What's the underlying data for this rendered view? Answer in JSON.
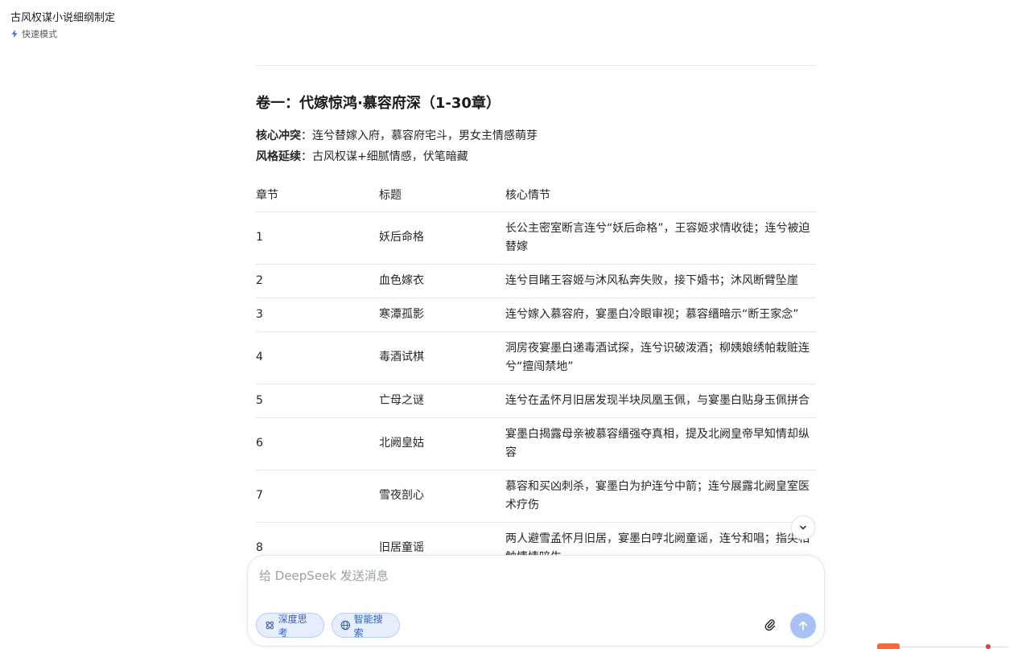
{
  "header": {
    "chat_title": "古风权谋小说细纲制定",
    "mode_label": "快速模式",
    "mode_icon": "lightning-icon"
  },
  "content": {
    "volume_heading": "卷一：代嫁惊鸿·慕容府深（1-30章）",
    "meta": [
      {
        "label": "核心冲突",
        "text": "：连兮替嫁入府，慕容府宅斗，男女主情感萌芽"
      },
      {
        "label": "风格延续",
        "text": "：古风权谋+细腻情感，伏笔暗藏"
      }
    ],
    "table": {
      "headers": [
        "章节",
        "标题",
        "核心情节"
      ],
      "rows": [
        {
          "ch": "1",
          "title": "妖后命格",
          "plot": "长公主密室断言连兮“妖后命格”，王容姬求情收徒；连兮被迫替嫁"
        },
        {
          "ch": "2",
          "title": "血色嫁衣",
          "plot": "连兮目睹王容姬与沐风私奔失败，接下婚书；沐风断臂坠崖"
        },
        {
          "ch": "3",
          "title": "寒潭孤影",
          "plot": "连兮嫁入慕容府，宴墨白冷眼审视；慕容缙暗示“断王家念”"
        },
        {
          "ch": "4",
          "title": "毒酒试棋",
          "plot": "洞房夜宴墨白递毒酒试探，连兮识破泼酒；柳姨娘绣帕栽赃连兮“擅闯禁地”"
        },
        {
          "ch": "5",
          "title": "亡母之谜",
          "plot": "连兮在孟怀月旧居发现半块凤凰玉佩，与宴墨白贴身玉佩拼合"
        },
        {
          "ch": "6",
          "title": "北阙皇姑",
          "plot": "宴墨白揭露母亲被慕容缙强夺真相，提及北阙皇帝早知情却纵容"
        },
        {
          "ch": "7",
          "title": "雪夜剖心",
          "plot": "慕容和买凶刺杀，宴墨白为护连兮中箭；连兮展露北阙皇室医术疗伤"
        },
        {
          "ch": "8",
          "title": "旧居童谣",
          "plot": "两人避雪孟怀月旧居，宴墨白哼北阙童谣，连兮和唱；指尖相触情愫暗生"
        }
      ]
    }
  },
  "composer": {
    "placeholder": "给 DeepSeek 发送消息",
    "value": "",
    "deep_think_label": "深度思考",
    "search_label": "智能搜索",
    "attach_icon": "paperclip-icon",
    "send_icon": "arrow-up-icon"
  },
  "colors": {
    "accent": "#3460c8",
    "chip_bg": "#e6eefc",
    "send_bg": "#a9c2f6"
  }
}
